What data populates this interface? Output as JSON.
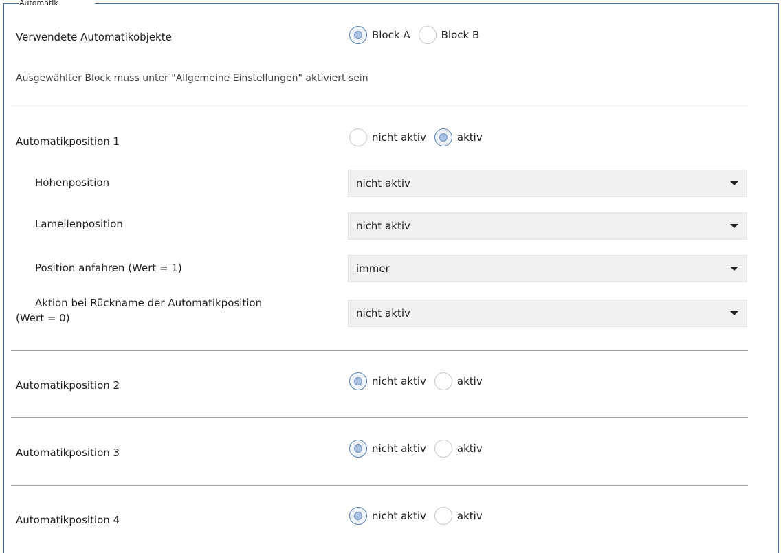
{
  "header": {
    "title": "Automatik"
  },
  "used_objects": {
    "label": "Verwendete Automatikobjekte",
    "options": [
      "Block A",
      "Block B"
    ],
    "selected": "Block A",
    "note": "Ausgewählter Block muss unter \"Allgemeine Einstellungen\" aktiviert sein"
  },
  "pos1": {
    "label": "Automatikposition 1",
    "options": [
      "nicht aktiv",
      "aktiv"
    ],
    "selected": "aktiv",
    "settings": [
      {
        "label": "Höhenposition",
        "value": "nicht aktiv"
      },
      {
        "label": "Lamellenposition",
        "value": "nicht aktiv"
      },
      {
        "label": "Position anfahren (Wert = 1)",
        "value": "immer"
      },
      {
        "label_line1": "Aktion bei Rückname der Automatikposition",
        "label_line2": "(Wert = 0)",
        "value": "nicht aktiv"
      }
    ]
  },
  "pos2": {
    "label": "Automatikposition 2",
    "options": [
      "nicht aktiv",
      "aktiv"
    ],
    "selected": "nicht aktiv"
  },
  "pos3": {
    "label": "Automatikposition 3",
    "options": [
      "nicht aktiv",
      "aktiv"
    ],
    "selected": "nicht aktiv"
  },
  "pos4": {
    "label": "Automatikposition 4",
    "options": [
      "nicht aktiv",
      "aktiv"
    ],
    "selected": "nicht aktiv"
  }
}
